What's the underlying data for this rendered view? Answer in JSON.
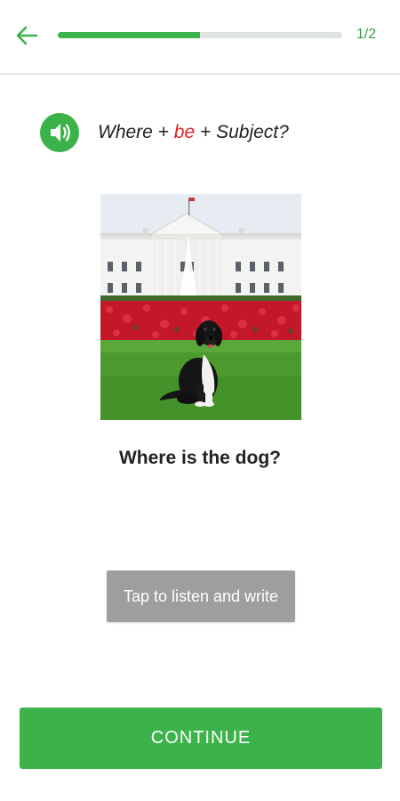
{
  "header": {
    "progress_text": "1/2",
    "progress_fraction": 0.5
  },
  "prompt": {
    "part1": "Where + ",
    "highlight": "be",
    "part2": " + Subject?"
  },
  "question": "Where is the dog?",
  "listen_button_label": "Tap to listen and write",
  "continue_button_label": "CONTINUE",
  "colors": {
    "accent": "#3cb34a",
    "highlight": "#e02020",
    "listen_button": "#9e9e9e"
  },
  "icons": {
    "back": "arrow-left-icon",
    "audio": "speaker-icon"
  }
}
